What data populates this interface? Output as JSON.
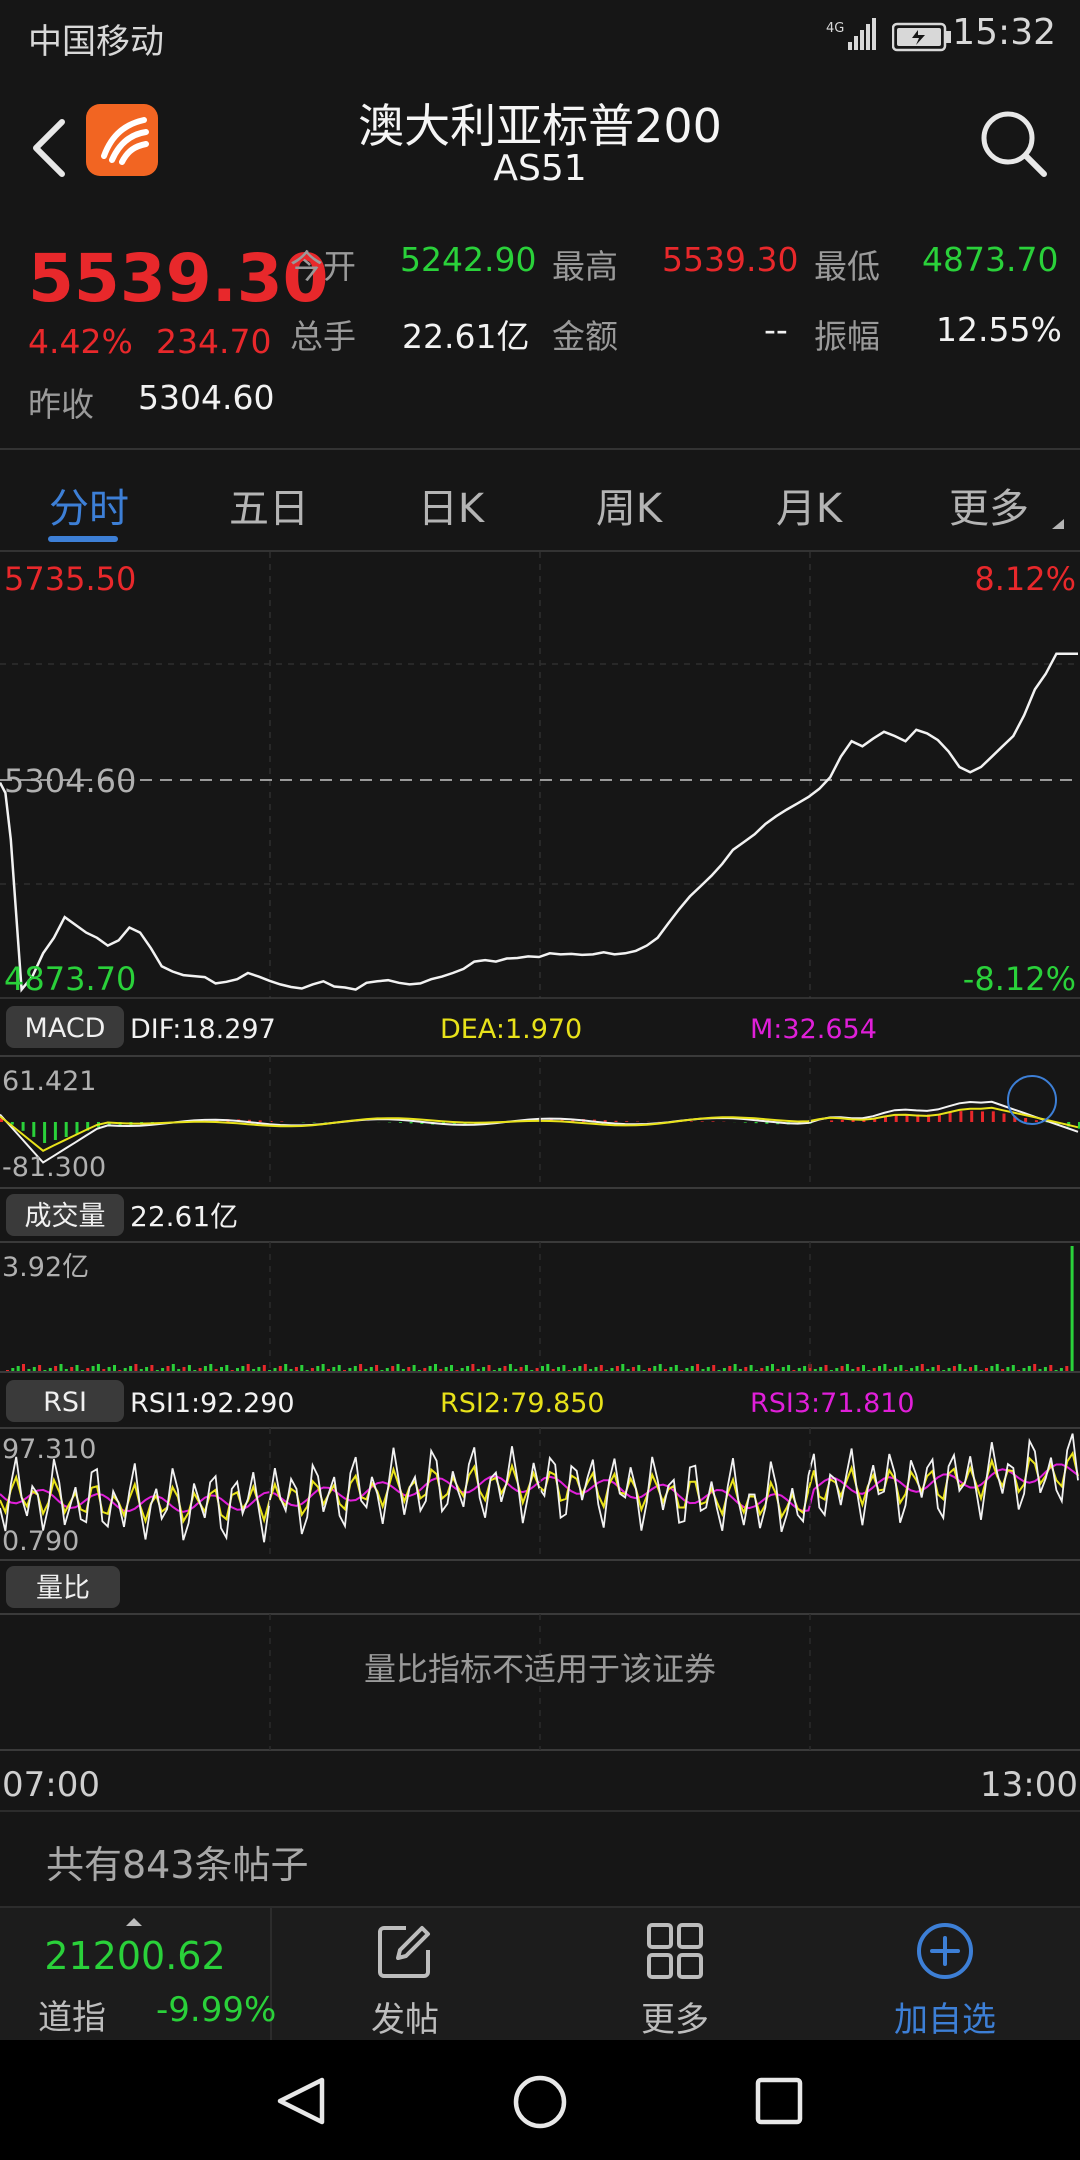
{
  "status": {
    "carrier": "中国移动",
    "network": "4G",
    "time": "15:32"
  },
  "header": {
    "title": "澳大利亚标普200",
    "code": "AS51"
  },
  "quote": {
    "price": "5539.30",
    "change_pct": "4.42%",
    "change": "234.70",
    "prev_close_label": "昨收",
    "prev_close": "5304.60",
    "open_label": "今开",
    "open": "5242.90",
    "high_label": "最高",
    "high": "5539.30",
    "low_label": "最低",
    "low": "4873.70",
    "volume_label": "总手",
    "volume": "22.61亿",
    "amount_label": "金额",
    "amount": "--",
    "amplitude_label": "振幅",
    "amplitude": "12.55%"
  },
  "tabs": {
    "items": [
      "分时",
      "五日",
      "日K",
      "周K",
      "月K",
      "更多"
    ],
    "active": "分时"
  },
  "chart_data": [
    {
      "type": "line",
      "name": "intraday-price",
      "y_max_label": "5735.50",
      "y_mid_label": "5304.60",
      "y_min_label": "4873.70",
      "pct_max_label": "8.12%",
      "pct_min_label": "-8.12%",
      "x_start": "07:00",
      "x_end": "13:00",
      "ylim": [
        4873.7,
        5735.5
      ],
      "reference": 5304.6,
      "x": [
        0,
        0.5,
        1,
        2,
        3,
        4,
        5,
        6,
        7,
        8,
        9,
        10,
        11,
        12,
        13,
        14,
        15,
        16,
        17,
        18,
        19,
        20,
        21,
        22,
        23,
        24,
        25,
        26,
        27,
        28,
        29,
        30,
        31,
        32,
        33,
        34,
        35,
        36,
        37,
        38,
        39,
        40,
        41,
        42,
        43,
        44,
        45,
        46,
        47,
        48,
        49,
        50,
        51,
        52,
        53,
        54,
        55,
        56,
        57,
        58,
        59,
        60,
        61,
        62,
        63,
        64,
        65,
        66,
        67,
        68,
        69,
        70,
        71,
        72,
        73,
        74,
        75,
        76,
        77,
        78,
        79,
        80,
        81,
        82,
        83,
        84,
        85,
        86,
        87,
        88,
        89,
        90,
        91,
        92,
        93,
        94,
        95,
        96,
        97,
        98,
        99,
        100
      ],
      "values": [
        5290,
        5270,
        5180,
        4890,
        4915,
        4960,
        4990,
        5030,
        5015,
        5000,
        4990,
        4975,
        4985,
        5010,
        5000,
        4970,
        4935,
        4925,
        4918,
        4916,
        4914,
        4902,
        4905,
        4910,
        4922,
        4915,
        4907,
        4900,
        4895,
        4892,
        4900,
        4906,
        4896,
        4894,
        4890,
        4903,
        4906,
        4908,
        4903,
        4900,
        4902,
        4910,
        4915,
        4922,
        4930,
        4944,
        4947,
        4944,
        4950,
        4951,
        4954,
        4953,
        4960,
        4958,
        4959,
        4957,
        4958,
        4962,
        4958,
        4960,
        4965,
        4975,
        4990,
        5018,
        5045,
        5070,
        5090,
        5110,
        5133,
        5160,
        5175,
        5190,
        5210,
        5225,
        5238,
        5250,
        5262,
        5278,
        5300,
        5340,
        5370,
        5360,
        5375,
        5388,
        5380,
        5370,
        5392,
        5385,
        5372,
        5350,
        5320,
        5310,
        5320,
        5340,
        5360,
        5380,
        5420,
        5470,
        5500,
        5539,
        5539,
        5539
      ]
    },
    {
      "type": "line",
      "name": "macd",
      "label": "MACD",
      "dif": "DIF:18.297",
      "dea": "DEA:1.970",
      "m": "M:32.654",
      "y_max_label": "61.421",
      "y_min_label": "-81.300"
    },
    {
      "type": "bar",
      "name": "volume",
      "label": "成交量",
      "total": "22.61亿",
      "y_max_label": "3.92亿"
    },
    {
      "type": "line",
      "name": "rsi",
      "label": "RSI",
      "rsi1": "RSI1:92.290",
      "rsi2": "RSI2:79.850",
      "rsi3": "RSI3:71.810",
      "y_max_label": "97.310",
      "y_min_label": "0.790"
    }
  ],
  "liangbi": {
    "label": "量比",
    "message": "量比指标不适用于该证券"
  },
  "time_axis": {
    "start": "07:00",
    "end": "13:00"
  },
  "posts": {
    "text": "共有843条帖子"
  },
  "bottom_bar": {
    "index_value": "21200.62",
    "index_name": "道指",
    "index_change": "-9.99%",
    "post_label": "发帖",
    "more_label": "更多",
    "add_label": "加自选"
  },
  "colors": {
    "up": "#e8282b",
    "down": "#2ad13a",
    "accent": "#3d7fd6",
    "dif": "#ffffff",
    "dea": "#e8e21a",
    "m": "#e01fd9"
  }
}
